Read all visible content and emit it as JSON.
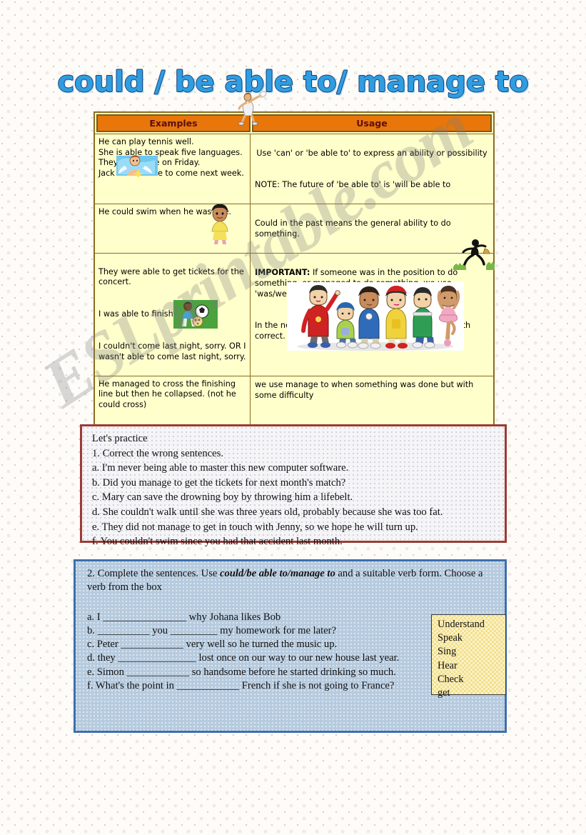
{
  "page": {
    "title": "could / be able to/ manage to",
    "watermark": "ESLprintable.com"
  },
  "table": {
    "headers": {
      "examples": "Examples",
      "usage": "Usage"
    },
    "rows": [
      {
        "examples": "He can play tennis well.\nShe is able to speak five languages.\nThey can come on Friday.\nJack will be able to come next week.",
        "usage_1": "Use 'can' or 'be able to' to express an ability or possibility",
        "usage_2": "NOTE: The future of 'be able to' is 'will be able to"
      },
      {
        "examples": "He could swim when he was five.",
        "usage_1": "Could in the past means the general ability to do something.",
        "usage_2": ""
      },
      {
        "examples_a": "They were able to get tickets for the concert.",
        "examples_b": "I was able to finish before 6.",
        "examples_c": "I couldn't come last night, sorry. OR I wasn't able to come last night, sorry.",
        "usage_label": "IMPORTANT:",
        "usage_1": " If someone was in the position to do something, or managed to do something, we use 'was/were able to instead of 'could'",
        "usage_2": "In the negative,' wasn't able to' OR 'couldn't' are both correct."
      },
      {
        "examples": "He managed to cross the finishing line but then he collapsed. (not he could cross)",
        "usage_1": "we use manage to when something was done but with some difficulty"
      }
    ]
  },
  "practice": {
    "heading": "Let's practice",
    "instruction": "1. Correct the wrong sentences.",
    "items": [
      "a. I'm never being able to master this new computer software.",
      "b. Did you manage to get the tickets for next month's match?",
      "c. Mary can save the drowning boy by throwing him a lifebelt.",
      "d. She couldn't walk until she was three years old, probably because she was too fat.",
      "e. They did not manage to get in touch with Jenny, so we hope he will turn up.",
      "f. You couldn't swim since you had that accident last month."
    ]
  },
  "exercise2": {
    "intro_before": "2. Complete the sentences. Use ",
    "intro_bold": "could/be able to/manage to",
    "intro_after": " and a suitable verb form. Choose a verb from the box",
    "items": [
      "a. I ________________ why Johana likes Bob",
      "b. __________ you _________ my homework for me later?",
      "c. Peter ____________ very well so he turned the music up.",
      "d. they _______________ lost once on our way to our new house last year.",
      "e. Simon ____________ so handsome before he started drinking so much.",
      "f. What's the point in ____________ French if she is not going to France?"
    ],
    "verb_box": [
      "Understand",
      "Speak",
      "Sing",
      "Hear",
      "Check",
      "get"
    ]
  },
  "colors": {
    "title_fill": "#2f9de0",
    "title_outline": "#16407e",
    "table_header_bg": "#e8760a",
    "table_cell_bg": "#ffffcc",
    "table_border": "#8a6d20",
    "practice_border": "#9b3b35",
    "exercise_bg": "#b7cbdf",
    "exercise_border": "#3d6fae",
    "verb_box_bg": "#f3e08a"
  }
}
